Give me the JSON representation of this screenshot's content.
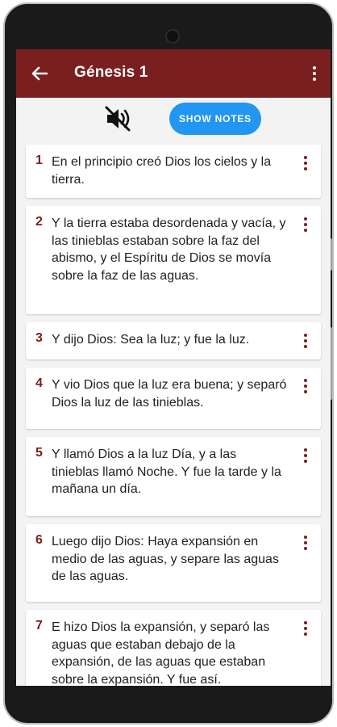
{
  "app_bar": {
    "title": "Génesis 1",
    "back_icon": "arrow-left-icon",
    "menu_icon": "more-vert-icon",
    "color": "#7a1f1f"
  },
  "toolbar": {
    "mute_icon": "volume-off-icon",
    "show_notes_label": "SHOW NOTES",
    "show_notes_color": "#2196f3"
  },
  "verses": [
    {
      "num": "1",
      "text": "En el principio creó Dios los cielos y la tierra."
    },
    {
      "num": "2",
      "text": "Y la tierra estaba desordenada y vacía, y las tinieblas estaban sobre la faz del abismo, y el Espíritu de Dios se movía sobre la faz de las aguas."
    },
    {
      "num": "3",
      "text": "Y dijo Dios: Sea la luz; y fue la luz."
    },
    {
      "num": "4",
      "text": "Y vio Dios que la luz era buena; y separó Dios la luz de las tinieblas."
    },
    {
      "num": "5",
      "text": "Y llamó Dios a la luz Día, y a las tinieblas llamó Noche. Y fue la tarde y la mañana un día."
    },
    {
      "num": "6",
      "text": "Luego dijo Dios: Haya expansión en medio de las aguas, y separe las aguas de las aguas."
    },
    {
      "num": "7",
      "text": "E hizo Dios la expansión, y separó las aguas que estaban debajo de la expansión, de las aguas que estaban sobre la expansión. Y fue así."
    }
  ]
}
